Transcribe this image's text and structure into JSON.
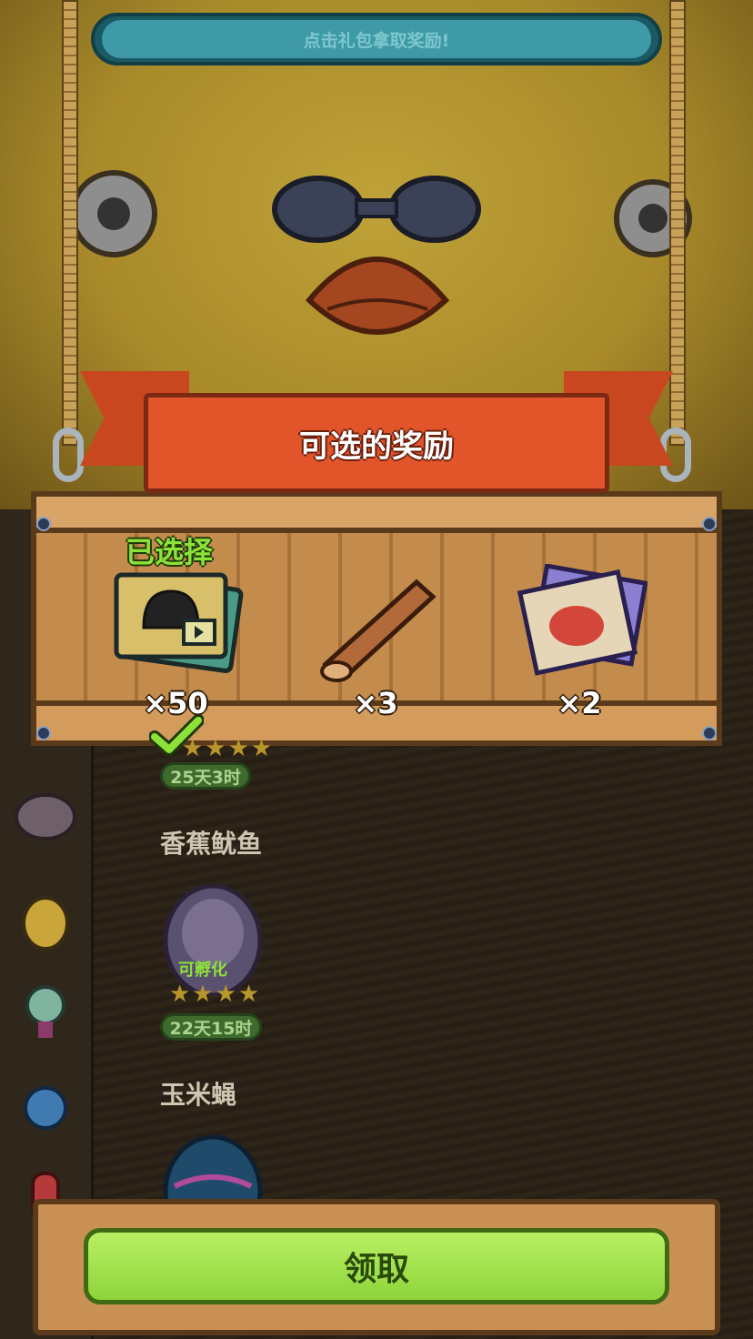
{
  "hint": {
    "text": "点击礼包拿取奖励!"
  },
  "banner": {
    "title": "可选的奖励"
  },
  "rewards": {
    "selected_label": "已选择",
    "items": [
      {
        "icon": "video-card-pack-icon",
        "count": "×50",
        "selected": true
      },
      {
        "icon": "wooden-log-icon",
        "count": "×3"
      },
      {
        "icon": "monster-map-scroll-icon",
        "count": "×2"
      }
    ]
  },
  "list": {
    "entry1": {
      "timer": "25天3时",
      "stars": "★★★★"
    },
    "entry2": {
      "name": "香蕉鱿鱼",
      "egg_status": "可孵化",
      "stars": "★★★★",
      "timer": "22天15时"
    },
    "entry3": {
      "name": "玉米蝇"
    }
  },
  "actions": {
    "claim_label": "领取"
  },
  "colors": {
    "accent_green": "#8ed43a",
    "banner_red": "#e2552a",
    "selected_green": "#8de23a"
  }
}
